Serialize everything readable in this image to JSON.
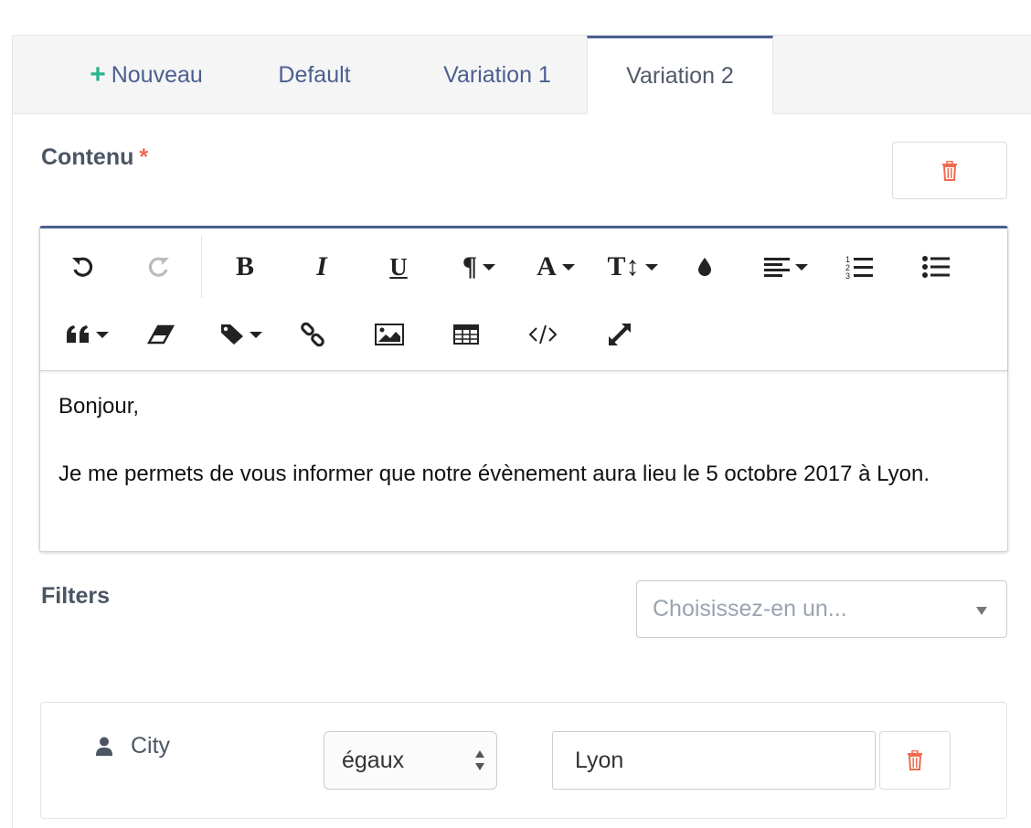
{
  "tabs": {
    "new_label": "Nouveau",
    "items": [
      "Default",
      "Variation 1",
      "Variation 2"
    ],
    "active": "Variation 2"
  },
  "content_section": {
    "label": "Contenu",
    "required_mark": "*"
  },
  "editor": {
    "toolbar_row1": [
      "undo-icon",
      "redo-icon",
      "bold-icon",
      "italic-icon",
      "underline-icon",
      "paragraph-icon",
      "font-color-icon",
      "font-size-icon",
      "color-drop-icon",
      "align-icon",
      "ordered-list-icon",
      "unordered-list-icon"
    ],
    "toolbar_row2": [
      "quote-icon",
      "eraser-icon",
      "tag-icon",
      "link-icon",
      "image-icon",
      "table-icon",
      "code-view-icon",
      "fullscreen-icon"
    ],
    "content_line1": "Bonjour,",
    "content_line2": "Je me permets de vous informer que notre évènement aura lieu le 5 octobre 2017 à Lyon."
  },
  "filters": {
    "label": "Filters",
    "select_placeholder": "Choisissez-en un...",
    "rows": [
      {
        "field": "City",
        "operator": "égaux",
        "value": "Lyon"
      }
    ]
  },
  "colors": {
    "accent": "#4b5f8f",
    "plus": "#2cb58f",
    "danger": "#ef6a4f"
  }
}
